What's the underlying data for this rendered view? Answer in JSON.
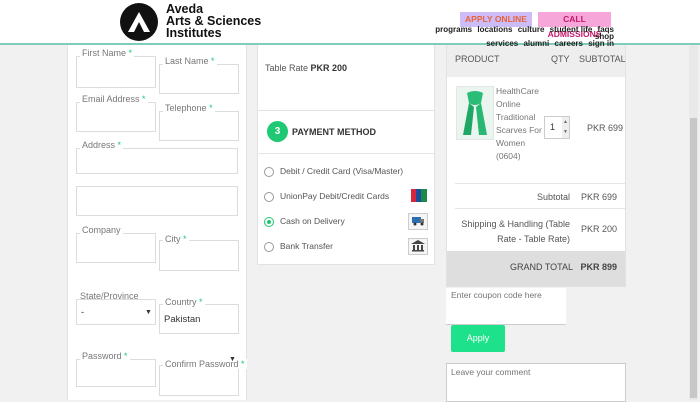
{
  "header": {
    "logo_lines": [
      "Aveda",
      "Arts & Sciences",
      "Institutes"
    ],
    "apply_label": "APPLY ONLINE",
    "call_label": "CALL ADMISSIONS",
    "nav_row1": [
      "programs",
      "locations",
      "culture",
      "student life",
      "faqs",
      "shop"
    ],
    "nav_row2": [
      "services",
      "alumni",
      "careers",
      "sign in"
    ]
  },
  "billing": {
    "first_name": "First Name",
    "last_name": "Last Name",
    "email": "Email Address",
    "telephone": "Telephone",
    "address": "Address",
    "company": "Company",
    "city": "City",
    "state": "State/Province",
    "state_value": "-",
    "country": "Country",
    "country_value": "Pakistan",
    "password": "Password",
    "confirm_password": "Confirm Password",
    "required_mark": "*"
  },
  "shipping": {
    "rate_label": "Table Rate",
    "rate_value": "PKR 200"
  },
  "payment": {
    "step": "3",
    "title": "PAYMENT METHOD",
    "options": [
      {
        "label": "Debit / Credit Card (Visa/Master)",
        "selected": false,
        "icon": ""
      },
      {
        "label": "UnionPay Debit/Credit Cards",
        "selected": false,
        "icon": "unionpay-icon"
      },
      {
        "label": "Cash on Delivery",
        "selected": true,
        "icon": "cash-delivery-icon"
      },
      {
        "label": "Bank Transfer",
        "selected": false,
        "icon": "bank-icon"
      }
    ]
  },
  "order": {
    "col_product": "PRODUCT",
    "col_qty": "QTY",
    "col_subtotal": "SUBTOTAL",
    "item_name_lines": [
      "HealthCare",
      "Online",
      "Traditional",
      "Scarves For",
      "Women",
      "(0604)"
    ],
    "item_qty": "1",
    "item_subtotal": "PKR 699",
    "subtotal_label": "Subtotal",
    "subtotal_value": "PKR 699",
    "shipping_label_lines": [
      "Shipping & Handling (Table",
      "Rate - Table Rate)"
    ],
    "shipping_value": "PKR 200",
    "grand_label": "GRAND TOTAL",
    "grand_value": "PKR 899"
  },
  "coupon": {
    "placeholder": "Enter coupon code here",
    "apply_label": "Apply"
  },
  "comment": {
    "placeholder": "Leave your comment"
  },
  "colors": {
    "accent_green": "#1fc873",
    "apply_button": "#1de28b",
    "header_rule": "#7fcdb9"
  }
}
